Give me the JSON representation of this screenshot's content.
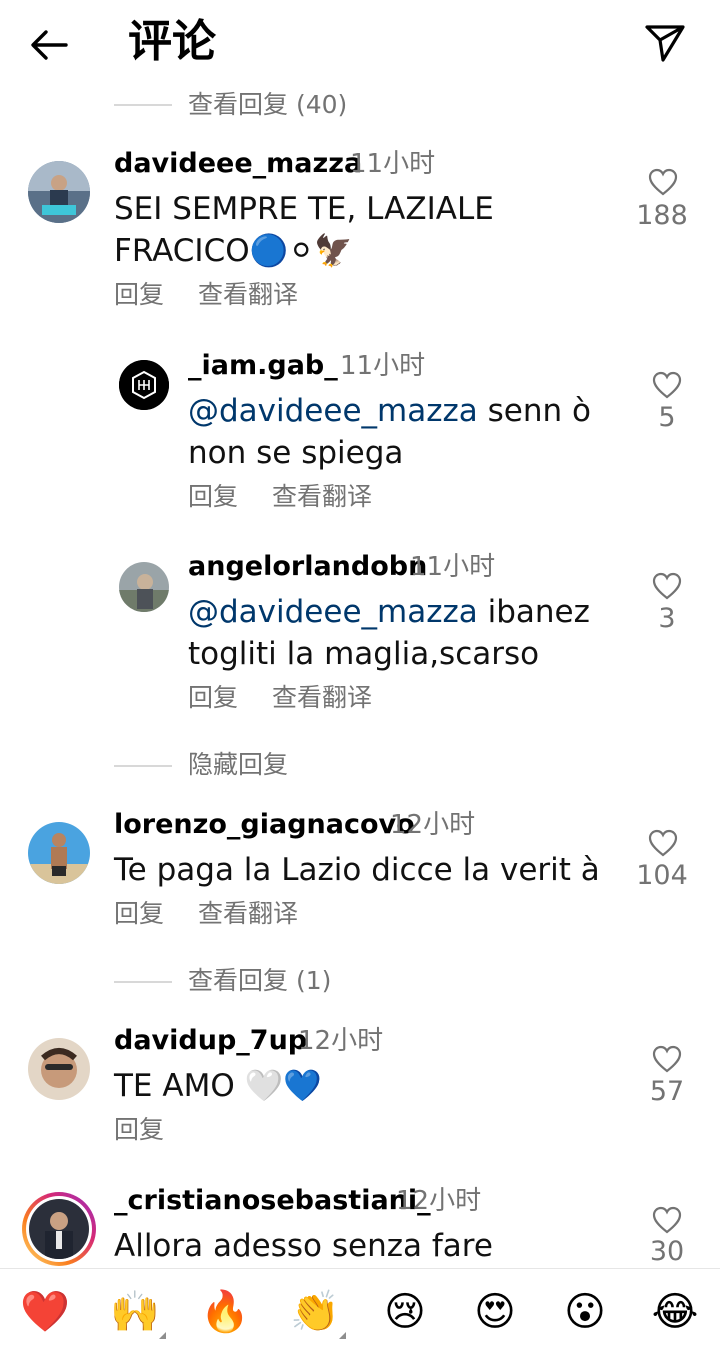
{
  "header": {
    "title": "评论"
  },
  "comments": [
    {
      "toggle": "查看回复 (40)",
      "user": "davideee_mazza",
      "time": "11小时",
      "line1": "SEI SEMPRE TE, LAZIALE",
      "line2": "FRACICO🔵⚪🦅",
      "reply": "回复",
      "translate": "查看翻译",
      "likes": "188"
    },
    {
      "user": "_iam.gab_",
      "time": "11小时",
      "mention": "@davideee_mazza",
      "line1": " senn ò",
      "line2": "non se spiega",
      "reply": "回复",
      "translate": "查看翻译",
      "likes": "5"
    },
    {
      "user": "angelorlandobn",
      "time": "11小时",
      "mention": "@davideee_mazza",
      "line1": " ibanez",
      "line2": "togliti la maglia,scarso",
      "reply": "回复",
      "translate": "查看翻译",
      "likes": "3"
    },
    {
      "toggle": "隐藏回复",
      "user": "lorenzo_giagnacovo",
      "time": "12小时",
      "line1": "Te paga la Lazio dicce la verit à",
      "reply": "回复",
      "translate": "查看翻译",
      "likes": "104"
    },
    {
      "toggle": "查看回复 (1)",
      "user": "davidup_7up",
      "time": "12小时",
      "line1": "TE AMO 🤍💙",
      "reply": "回复",
      "likes": "57"
    },
    {
      "user": "_cristianosebastiani_",
      "time": "12小时",
      "line1": "Allora adesso senza fare",
      "likes": "30"
    }
  ],
  "emoji_bar": [
    "❤️",
    "🙌",
    "🔥",
    "👏",
    "😢",
    "😍",
    "😮",
    "😂"
  ],
  "colors": {
    "link": "#00376b",
    "muted": "#737373",
    "story_ring": "#d6249f"
  }
}
